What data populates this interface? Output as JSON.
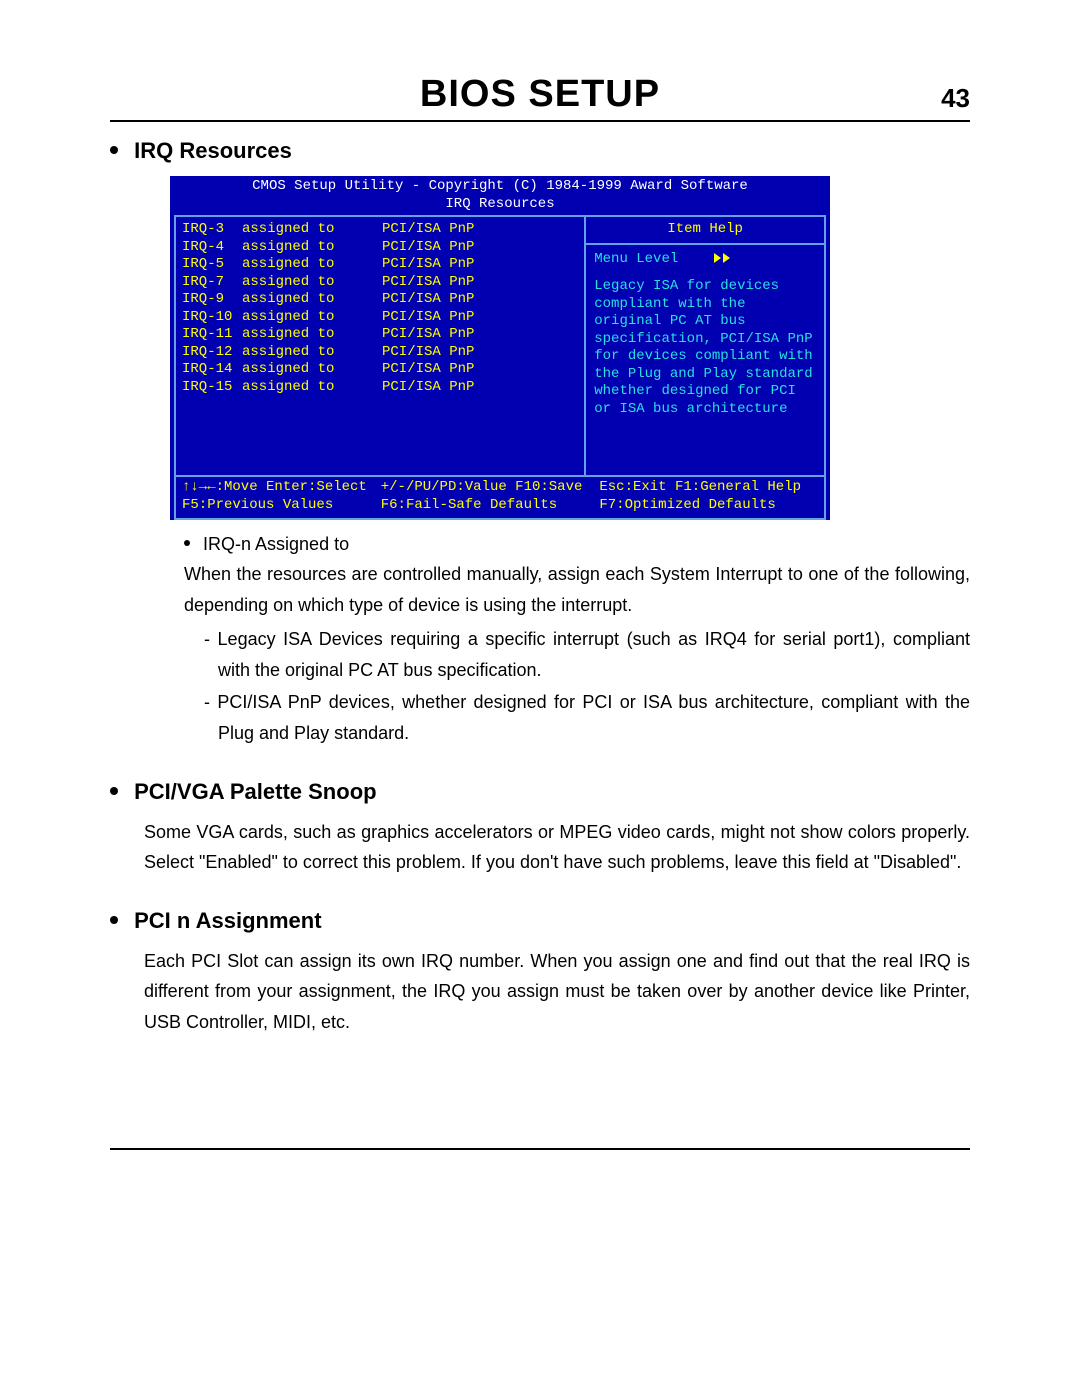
{
  "header": {
    "title": "BIOS SETUP",
    "page_number": "43"
  },
  "section_irq": {
    "title": "IRQ Resources"
  },
  "bios": {
    "title_line1": "CMOS Setup Utility - Copyright (C) 1984-1999 Award Software",
    "title_line2": "IRQ Resources",
    "help_title": "Item Help",
    "menu_level_label": "Menu Level",
    "help_text": "Legacy ISA for devices compliant with the original PC AT bus specification, PCI/ISA PnP for devices compliant with the Plug and Play standard whether designed for PCI or ISA bus architecture",
    "rows": [
      {
        "irq": "IRQ-3",
        "label": "assigned to",
        "value": "PCI/ISA PnP"
      },
      {
        "irq": "IRQ-4",
        "label": "assigned to",
        "value": "PCI/ISA PnP"
      },
      {
        "irq": "IRQ-5",
        "label": "assigned to",
        "value": "PCI/ISA PnP"
      },
      {
        "irq": "IRQ-7",
        "label": "assigned to",
        "value": "PCI/ISA PnP"
      },
      {
        "irq": "IRQ-9",
        "label": "assigned to",
        "value": "PCI/ISA PnP"
      },
      {
        "irq": "IRQ-10",
        "label": "assigned to",
        "value": "PCI/ISA PnP"
      },
      {
        "irq": "IRQ-11",
        "label": "assigned to",
        "value": "PCI/ISA PnP"
      },
      {
        "irq": "IRQ-12",
        "label": "assigned to",
        "value": "PCI/ISA PnP"
      },
      {
        "irq": "IRQ-14",
        "label": "assigned to",
        "value": "PCI/ISA PnP"
      },
      {
        "irq": "IRQ-15",
        "label": "assigned to",
        "value": "PCI/ISA PnP"
      }
    ],
    "footer": {
      "c1a": "↑↓→←:Move  Enter:Select",
      "c1b": "F5:Previous Values",
      "c2a": "+/-/PU/PD:Value  F10:Save",
      "c2b": "F6:Fail-Safe Defaults",
      "c3a": "Esc:Exit  F1:General Help",
      "c3b": "F7:Optimized Defaults"
    }
  },
  "irq_sub": {
    "label": "IRQ-n Assigned to",
    "para": "When the resources are controlled manually, assign each System Interrupt to one of the following, depending on which type of device is using the interrupt.",
    "dash1": "- Legacy ISA Devices requiring a specific interrupt (such as IRQ4 for serial port1), compliant with the original PC AT bus specification.",
    "dash2": "- PCI/ISA PnP devices, whether designed for PCI or ISA bus architecture, compliant with the Plug and Play standard."
  },
  "section_pci_vga": {
    "title": "PCI/VGA Palette Snoop",
    "para": "Some VGA cards, such as graphics accelerators or MPEG video cards, might not show colors properly.  Select \"Enabled\" to correct this problem.  If you don't have such problems, leave this field at \"Disabled\"."
  },
  "section_pci_n": {
    "title": "PCI n Assignment",
    "para": "Each PCI Slot can assign its own IRQ number.  When you assign one and find out that the real IRQ is different from your assignment, the IRQ you assign must be taken over by another device like Printer, USB Controller, MIDI, etc."
  }
}
